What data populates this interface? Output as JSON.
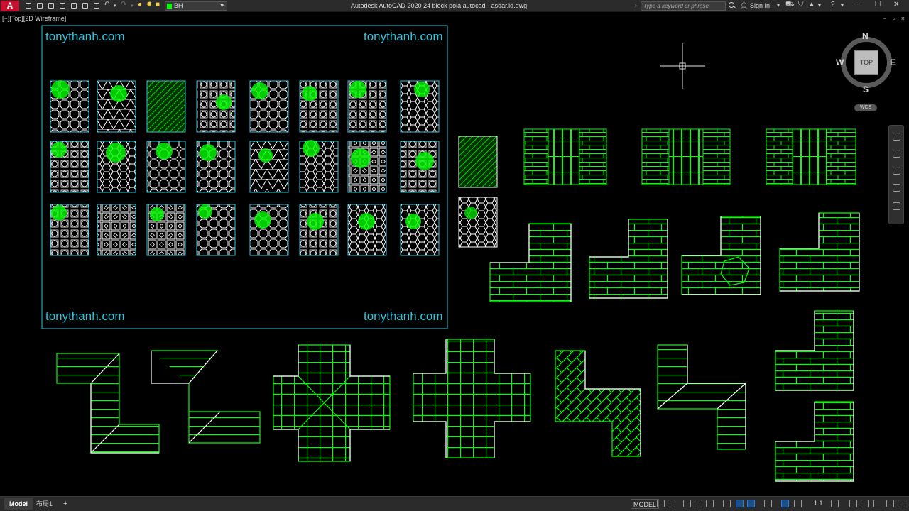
{
  "titlebar": {
    "app_logo": "A",
    "layer_name": "BH",
    "layer_color": "#00ff00",
    "title": "Autodesk AutoCAD 2020    24 block pola autocad - asdar.id.dwg",
    "search_placeholder": "Type a keyword or phrase",
    "sign_in": "Sign In"
  },
  "viewport": {
    "label": "[−][Top][2D Wireframe]",
    "window_controls": "− ▫ ×"
  },
  "watermarks": {
    "top_left": "tonythanh.com",
    "top_right": "tonythanh.com",
    "bottom_left": "tonythanh.com",
    "bottom_right": "tonythanh.com"
  },
  "viewcube": {
    "north": "N",
    "south": "S",
    "east": "E",
    "west": "W",
    "face": "TOP",
    "wcs": "WCS"
  },
  "statusbar": {
    "tabs": [
      "Model",
      "布局1",
      "+"
    ],
    "model_button": "MODEL",
    "scale": "1:1"
  },
  "colors": {
    "background": "#000000",
    "pattern_green": "#00ff00",
    "frame_cyan": "#2ec3d9",
    "outline": "#ffffff"
  }
}
